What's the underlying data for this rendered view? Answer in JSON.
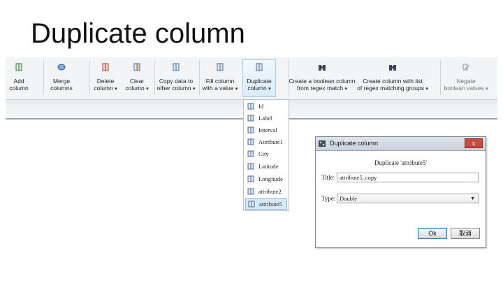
{
  "slide_title": "Duplicate column",
  "ribbon": {
    "buttons": [
      {
        "name": "add-column-button",
        "line1": "Add",
        "line2": "column",
        "icon": "add-column-icon"
      },
      {
        "name": "merge-columns-button",
        "line1": "Merge",
        "line2": "columns",
        "icon": "merge-columns-icon"
      },
      {
        "name": "delete-column-button",
        "line1": "Delete",
        "line2": "column",
        "icon": "delete-column-icon",
        "dropdown": true
      },
      {
        "name": "clear-column-button",
        "line1": "Clear",
        "line2": "column",
        "icon": "clear-column-icon",
        "dropdown": true
      },
      {
        "name": "copy-data-button",
        "line1": "Copy data to",
        "line2": "other column",
        "icon": "copy-data-icon",
        "dropdown": true
      },
      {
        "name": "fill-column-button",
        "line1": "Fill column",
        "line2": "with a value",
        "icon": "fill-column-icon",
        "dropdown": true
      },
      {
        "name": "duplicate-column-button",
        "line1": "Duplicate",
        "line2": "column",
        "icon": "duplicate-column-icon",
        "dropdown": true,
        "active": true
      },
      {
        "name": "boolean-regex-button",
        "line1": "Create a boolean column",
        "line2": "from regex match",
        "icon": "binoculars-icon",
        "dropdown": true
      },
      {
        "name": "regex-groups-button",
        "line1": "Create column with list",
        "line2": "of regex matching groups",
        "icon": "binoculars-icon",
        "dropdown": true
      },
      {
        "name": "negate-boolean-button",
        "line1": "Negate",
        "line2": "boolean values",
        "icon": "negate-icon",
        "dropdown": true,
        "disabled": true
      }
    ]
  },
  "dropdown": {
    "items": [
      "Id",
      "Label",
      "Interval",
      "Attribute1",
      "City",
      "Latitude",
      "Longitude",
      "attribute2",
      "attribute5"
    ],
    "selected": "attribute5"
  },
  "dialog": {
    "title": "Duplicate column",
    "close_label": "x",
    "heading": "Duplicate 'attribute5'",
    "title_label": "Title:",
    "title_value": "attribute5_copy",
    "type_label": "Type:",
    "type_value": "Double",
    "ok_label": "Ok",
    "cancel_label": "取消"
  },
  "colors": {
    "accent": "#3c7fb1",
    "active_tab": "#d9ebfb",
    "close_button": "#c94b3f"
  }
}
